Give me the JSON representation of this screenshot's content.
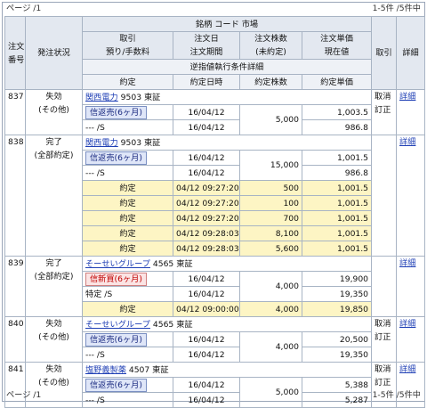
{
  "pager": {
    "page_label": "ページ /1",
    "count_label": "1-5件 /5件中"
  },
  "header": {
    "order_no": [
      "注文",
      "番号"
    ],
    "status": "発注状況",
    "stock": "銘柄 コード 市場",
    "trade": [
      "取引",
      "預り/手数料"
    ],
    "date": [
      "注文日",
      "注文期間"
    ],
    "qty": [
      "注文株数",
      "(未約定)"
    ],
    "price": [
      "注文単価",
      "現在値"
    ],
    "cancel": "取引",
    "detail": "詳細",
    "reverse": "逆指値執行条件詳細",
    "exec": "約定",
    "exec_time": "約定日時",
    "exec_qty": "約定株数",
    "exec_price": "約定単価"
  },
  "orders": [
    {
      "no": "837",
      "status": [
        "失効",
        "(その他)"
      ],
      "name": "関西電力",
      "code": "9503",
      "market": "東証",
      "trade": "信返売(6ヶ月)",
      "trade_sub": "--- /S",
      "date": "16/04/12",
      "period": "16/04/12",
      "qty": "5,000",
      "price": "1,003.5",
      "current": "986.8",
      "actions": [
        "取消",
        "訂正"
      ],
      "detail": "詳細",
      "executions": []
    },
    {
      "no": "838",
      "status": [
        "完了",
        "(全部約定)"
      ],
      "name": "関西電力",
      "code": "9503",
      "market": "東証",
      "trade": "信返売(6ヶ月)",
      "trade_sub": "--- /S",
      "date": "16/04/12",
      "period": "16/04/12",
      "qty": "15,000",
      "price": "1,001.5",
      "current": "986.8",
      "actions": [
        "取消",
        "訂正"
      ],
      "detail": "詳細",
      "executions": [
        {
          "label": "約定",
          "time": "04/12 09:27:20",
          "qty": "500",
          "price": "1,001.5"
        },
        {
          "label": "約定",
          "time": "04/12 09:27:20",
          "qty": "100",
          "price": "1,001.5"
        },
        {
          "label": "約定",
          "time": "04/12 09:27:20",
          "qty": "700",
          "price": "1,001.5"
        },
        {
          "label": "約定",
          "time": "04/12 09:28:03",
          "qty": "8,100",
          "price": "1,001.5"
        },
        {
          "label": "約定",
          "time": "04/12 09:28:03",
          "qty": "5,600",
          "price": "1,001.5"
        }
      ]
    },
    {
      "no": "839",
      "status": [
        "完了",
        "(全部約定)"
      ],
      "name": "そーせいグループ",
      "code": "4565",
      "market": "東証",
      "trade": "信新買(6ヶ月)",
      "trade_sub": "特定 /S",
      "date": "16/04/12",
      "period": "16/04/12",
      "qty": "4,000",
      "price": "19,900",
      "current": "19,350",
      "actions": [
        "取消",
        "訂正"
      ],
      "detail": "詳細",
      "executions": [
        {
          "label": "約定",
          "time": "04/12 09:00:00",
          "qty": "4,000",
          "price": "19,850"
        }
      ]
    },
    {
      "no": "840",
      "status": [
        "失効",
        "(その他)"
      ],
      "name": "そーせいグループ",
      "code": "4565",
      "market": "東証",
      "trade": "信返売(6ヶ月)",
      "trade_sub": "--- /S",
      "date": "16/04/12",
      "period": "16/04/12",
      "qty": "4,000",
      "price": "20,500",
      "current": "19,350",
      "actions": [
        "取消",
        "訂正"
      ],
      "detail": "詳細",
      "executions": []
    },
    {
      "no": "841",
      "status": [
        "失効",
        "(その他)"
      ],
      "name": "塩野義製薬",
      "code": "4507",
      "market": "東証",
      "trade": "信返売(6ヶ月)",
      "trade_sub": "--- /S",
      "date": "16/04/12",
      "period": "16/04/12",
      "qty": "5,000",
      "price": "5,388",
      "current": "5,287",
      "actions": [
        "取消",
        "訂正"
      ],
      "detail": "詳細",
      "executions": []
    }
  ]
}
